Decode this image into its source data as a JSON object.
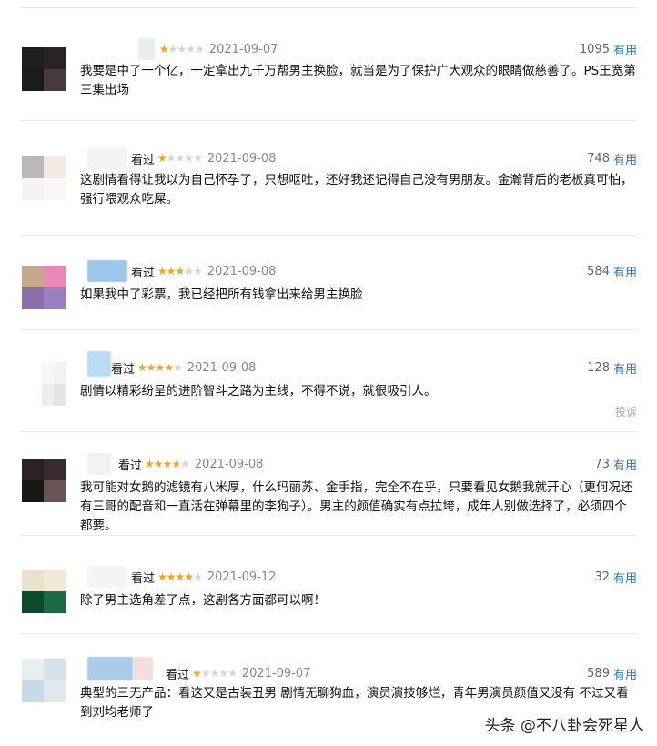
{
  "page": {
    "watermark": "头条 @不八卦会死星人"
  },
  "colors": {
    "star_on": "#f4a21c",
    "star_off": "#d6d6d6",
    "useful_link": "#3377aa"
  },
  "reviews": [
    {
      "watched": "",
      "stars": 1,
      "date": "2021-09-07",
      "votes": "1095",
      "useful": "有用",
      "text": "我要是中了一个亿，一定拿出九千万帮男主换脸，就当是为了保护广大观众的眼睛做慈善了。PS王宽第三集出场"
    },
    {
      "watched": "看过",
      "stars": 1,
      "date": "2021-09-08",
      "votes": "748",
      "useful": "有用",
      "text": "这剧情看得让我以为自己怀孕了，只想呕吐，还好我还记得自己没有男朋友。金瀚背后的老板真可怕，强行喂观众吃屎。"
    },
    {
      "watched": "看过",
      "stars": 3,
      "date": "2021-09-08",
      "votes": "584",
      "useful": "有用",
      "text": "如果我中了彩票，我已经把所有钱拿出来给男主换脸"
    },
    {
      "watched": "看过",
      "stars": 4,
      "date": "2021-09-08",
      "votes": "128",
      "useful": "有用",
      "text": "剧情以精彩纷呈的进阶智斗之路为主线，不得不说，就很吸引人。",
      "report": "投诉"
    },
    {
      "watched": "看过",
      "stars": 4,
      "date": "2021-09-08",
      "votes": "73",
      "useful": "有用",
      "text": "我可能对女鹅的滤镜有八米厚，什么玛丽苏、金手指，完全不在乎，只要看见女鹅我就开心（更何况还有三哥的配音和一直活在弹幕里的李狗子）。男主的颜值确实有点拉垮，成年人别做选择了，必须四个都要。"
    },
    {
      "watched": "看过",
      "stars": 4,
      "date": "2021-09-12",
      "votes": "32",
      "useful": "有用",
      "text": "除了男主选角差了点，这剧各方面都可以啊！"
    },
    {
      "watched": "看过",
      "stars": 1,
      "date": "2021-09-07",
      "votes": "589",
      "useful": "有用",
      "text": "典型的三无产品：看这又是古装丑男 剧情无聊狗血，演员演技够烂，青年男演员颜值又没有 不过又看到刘均老师了"
    }
  ]
}
